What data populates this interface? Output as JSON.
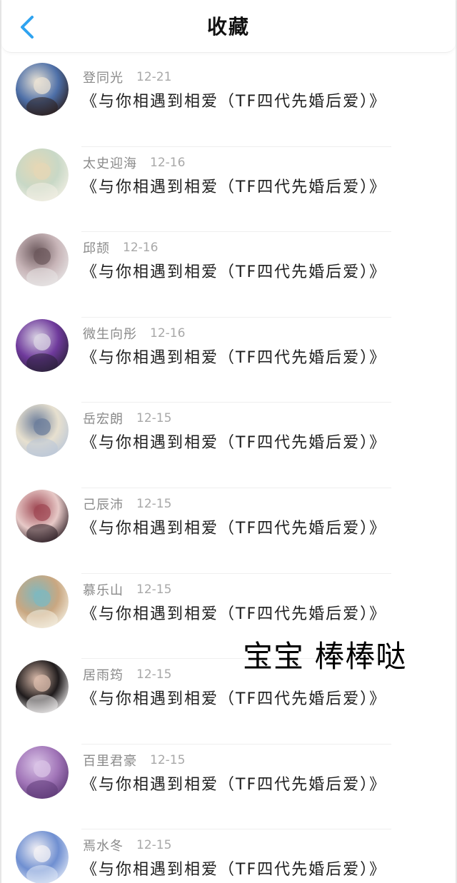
{
  "header": {
    "title": "收藏",
    "back_icon": "chevron-left-icon",
    "accent": "#2fa3f0"
  },
  "items": [
    {
      "author": "登同光",
      "date": "12-21",
      "title": "《与你相遇到相爱（TF四代先婚后爱）》",
      "avatar": "anime-character-avatar",
      "colors": [
        "#2b1d1a",
        "#4d6fa8",
        "#e9e2d4"
      ]
    },
    {
      "author": "太史迎海",
      "date": "12-16",
      "title": "《与你相遇到相爱（TF四代先婚后爱）》",
      "avatar": "cartoon-face-avatar",
      "colors": [
        "#f2efe4",
        "#c8d8c6",
        "#e5d7b5"
      ]
    },
    {
      "author": "邱颉",
      "date": "12-16",
      "title": "《与你相遇到相爱（TF四代先婚后爱）》",
      "avatar": "girl-photo-avatar",
      "colors": [
        "#e8e6e6",
        "#c8b5b8",
        "#6d5a5e"
      ]
    },
    {
      "author": "微生向彤",
      "date": "12-16",
      "title": "《与你相遇到相爱（TF四代先婚后爱）》",
      "avatar": "purple-car-avatar",
      "colors": [
        "#2a2138",
        "#6f3a9c",
        "#d9d3e3"
      ]
    },
    {
      "author": "岳宏朗",
      "date": "12-15",
      "title": "《与你相遇到相爱（TF四代先婚后爱）》",
      "avatar": "anime-boy-avatar",
      "colors": [
        "#b9c6d9",
        "#e7e0cf",
        "#6e7f9c"
      ]
    },
    {
      "author": "己辰沛",
      "date": "12-15",
      "title": "《与你相遇到相爱（TF四代先婚后爱）》",
      "avatar": "anime-girl-avatar",
      "colors": [
        "#2a1c22",
        "#e7c9c7",
        "#a04a55"
      ]
    },
    {
      "author": "慕乐山",
      "date": "12-15",
      "title": "《与你相遇到相爱（TF四代先婚后爱）》",
      "avatar": "sunlight-girl-avatar",
      "colors": [
        "#f4efe0",
        "#c9a781",
        "#7fb8bf"
      ]
    },
    {
      "author": "居雨筠",
      "date": "12-15",
      "title": "《与你相遇到相爱（TF四代先婚后爱）》",
      "avatar": "boy-photo-avatar",
      "colors": [
        "#f0eeee",
        "#1f1b1c",
        "#d8b9a9"
      ]
    },
    {
      "author": "百里君豪",
      "date": "12-15",
      "title": "《与你相遇到相爱（TF四代先婚后爱）》",
      "avatar": "purple-drops-avatar",
      "colors": [
        "#5d3a76",
        "#a175b8",
        "#d9c3e6"
      ]
    },
    {
      "author": "焉水冬",
      "date": "12-15",
      "title": "《与你相遇到相爱（TF四代先婚后爱）》",
      "avatar": "blue-hair-anime-avatar",
      "colors": [
        "#dfe7f6",
        "#6f8fd1",
        "#f2f0f4"
      ]
    }
  ],
  "overlay": {
    "text": "宝宝 棒棒哒"
  }
}
